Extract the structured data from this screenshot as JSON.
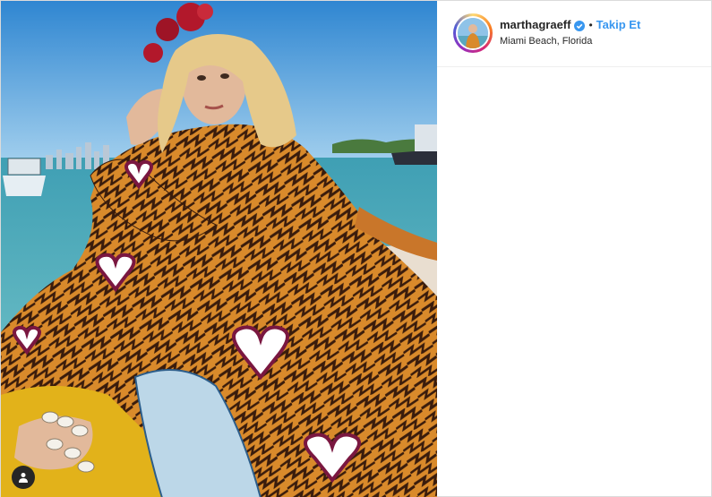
{
  "post": {
    "username": "marthagraeff",
    "separator": "•",
    "follow_label": "Takip Et",
    "location": "Miami Beach, Florida"
  },
  "icons": {
    "verified": "verified-badge-icon",
    "tagged_user": "user-icon"
  },
  "colors": {
    "accent": "#3897f0",
    "text": "#262626",
    "border": "#dbdbdb"
  }
}
